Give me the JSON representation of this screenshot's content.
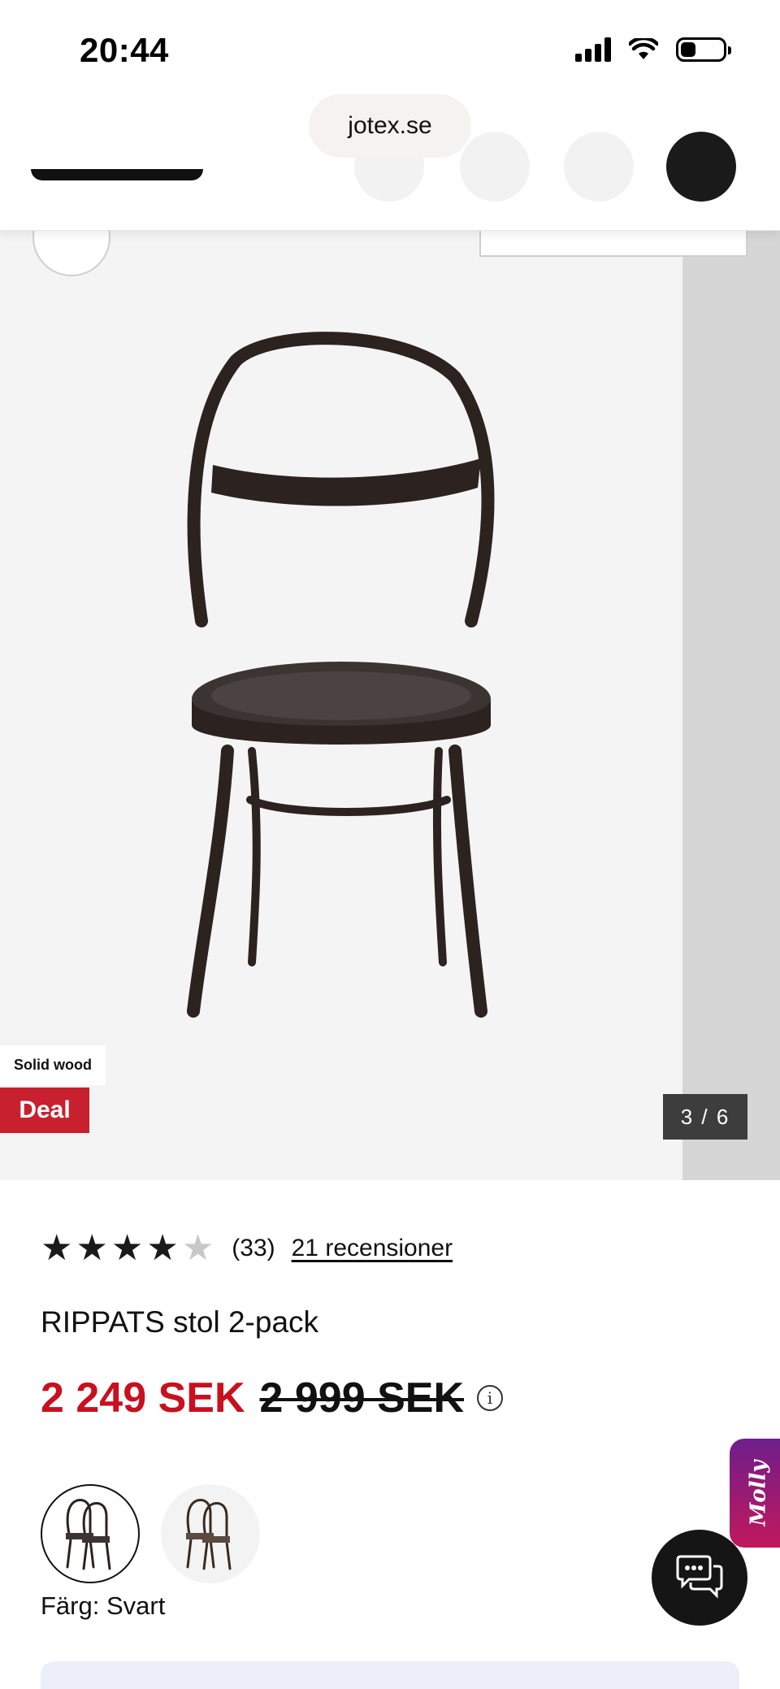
{
  "status_bar": {
    "time": "20:44"
  },
  "browser": {
    "url": "jotex.se"
  },
  "gallery": {
    "badge_material": "Solid wood",
    "badge_deal": "Deal",
    "counter": "3 / 6"
  },
  "product": {
    "rating": 4,
    "rating_max": 5,
    "rating_count": "(33)",
    "reviews_link": "21 recensioner",
    "title": "RIPPATS stol 2-pack",
    "price_now": "2 249 SEK",
    "price_was": "2 999 SEK",
    "info_icon": "i",
    "color_label": "Färg: Svart"
  },
  "floating": {
    "molly_label": "Molly"
  },
  "colors": {
    "price_red": "#c8101e",
    "deal_red": "#c8202e",
    "chair": "#2c2220"
  }
}
